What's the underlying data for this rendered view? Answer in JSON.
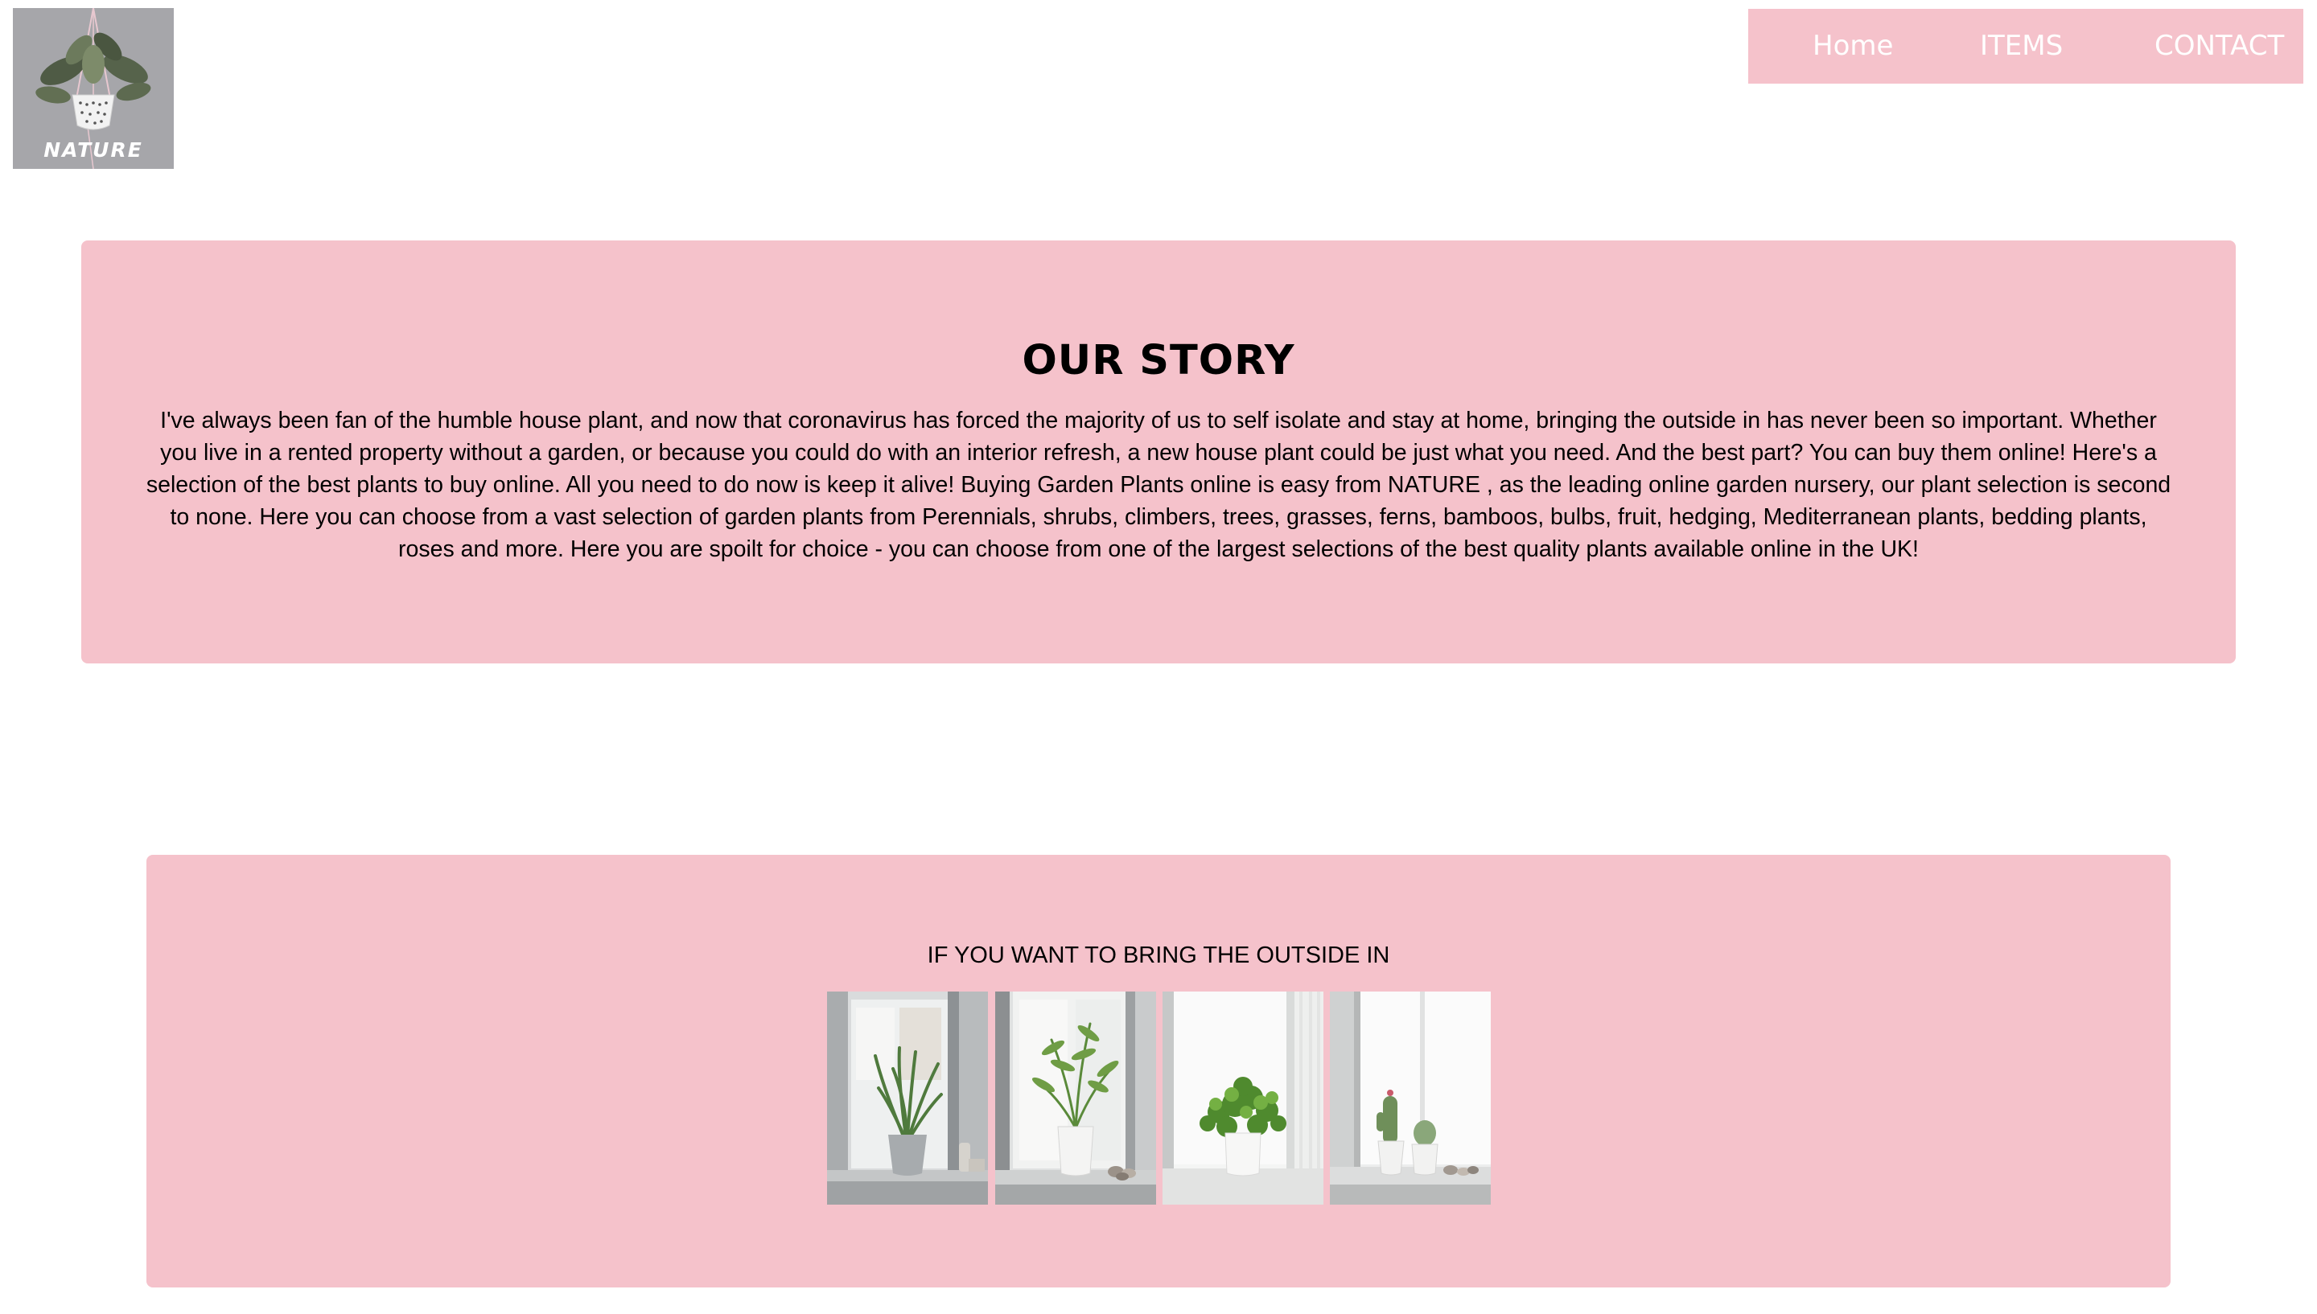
{
  "header": {
    "logo_text": "NATURE",
    "nav": {
      "home": "Home",
      "items": "ITEMS",
      "contact": "CONTACT"
    }
  },
  "story": {
    "title": "OUR STORY",
    "body": "I've always been fan of the humble house plant, and now that coronavirus has forced the majority of us to self isolate and stay at home, bringing the outside in has never been so important. Whether you live in a rented property without a garden, or because you could do with an interior refresh, a new house plant could be just what you need. And the best part? You can buy them online! Here's a selection of the best plants to buy online. All you need to do now is keep it alive! Buying Garden Plants online is easy from NATURE , as the leading online garden nursery, our plant selection is second to none. Here you can choose from a vast selection of garden plants from Perennials, shrubs, climbers, trees, grasses, ferns, bamboos, bulbs, fruit, hedging, Mediterranean plants, bedding plants, roses and more. Here you are spoilt for choice - you can choose from one of the largest selections of the best quality plants available online in the UK!"
  },
  "outside": {
    "title": "IF YOU WANT TO BRING THE OUTSIDE IN",
    "photos": [
      "grass-plant-photo",
      "palm-plant-photo",
      "ivy-plant-photo",
      "cactus-plant-photo"
    ]
  },
  "colors": {
    "accent_pink": "#f5c2cb",
    "logo_bg": "#a6a6aa",
    "text": "#000000",
    "nav_text": "#ffffff"
  }
}
